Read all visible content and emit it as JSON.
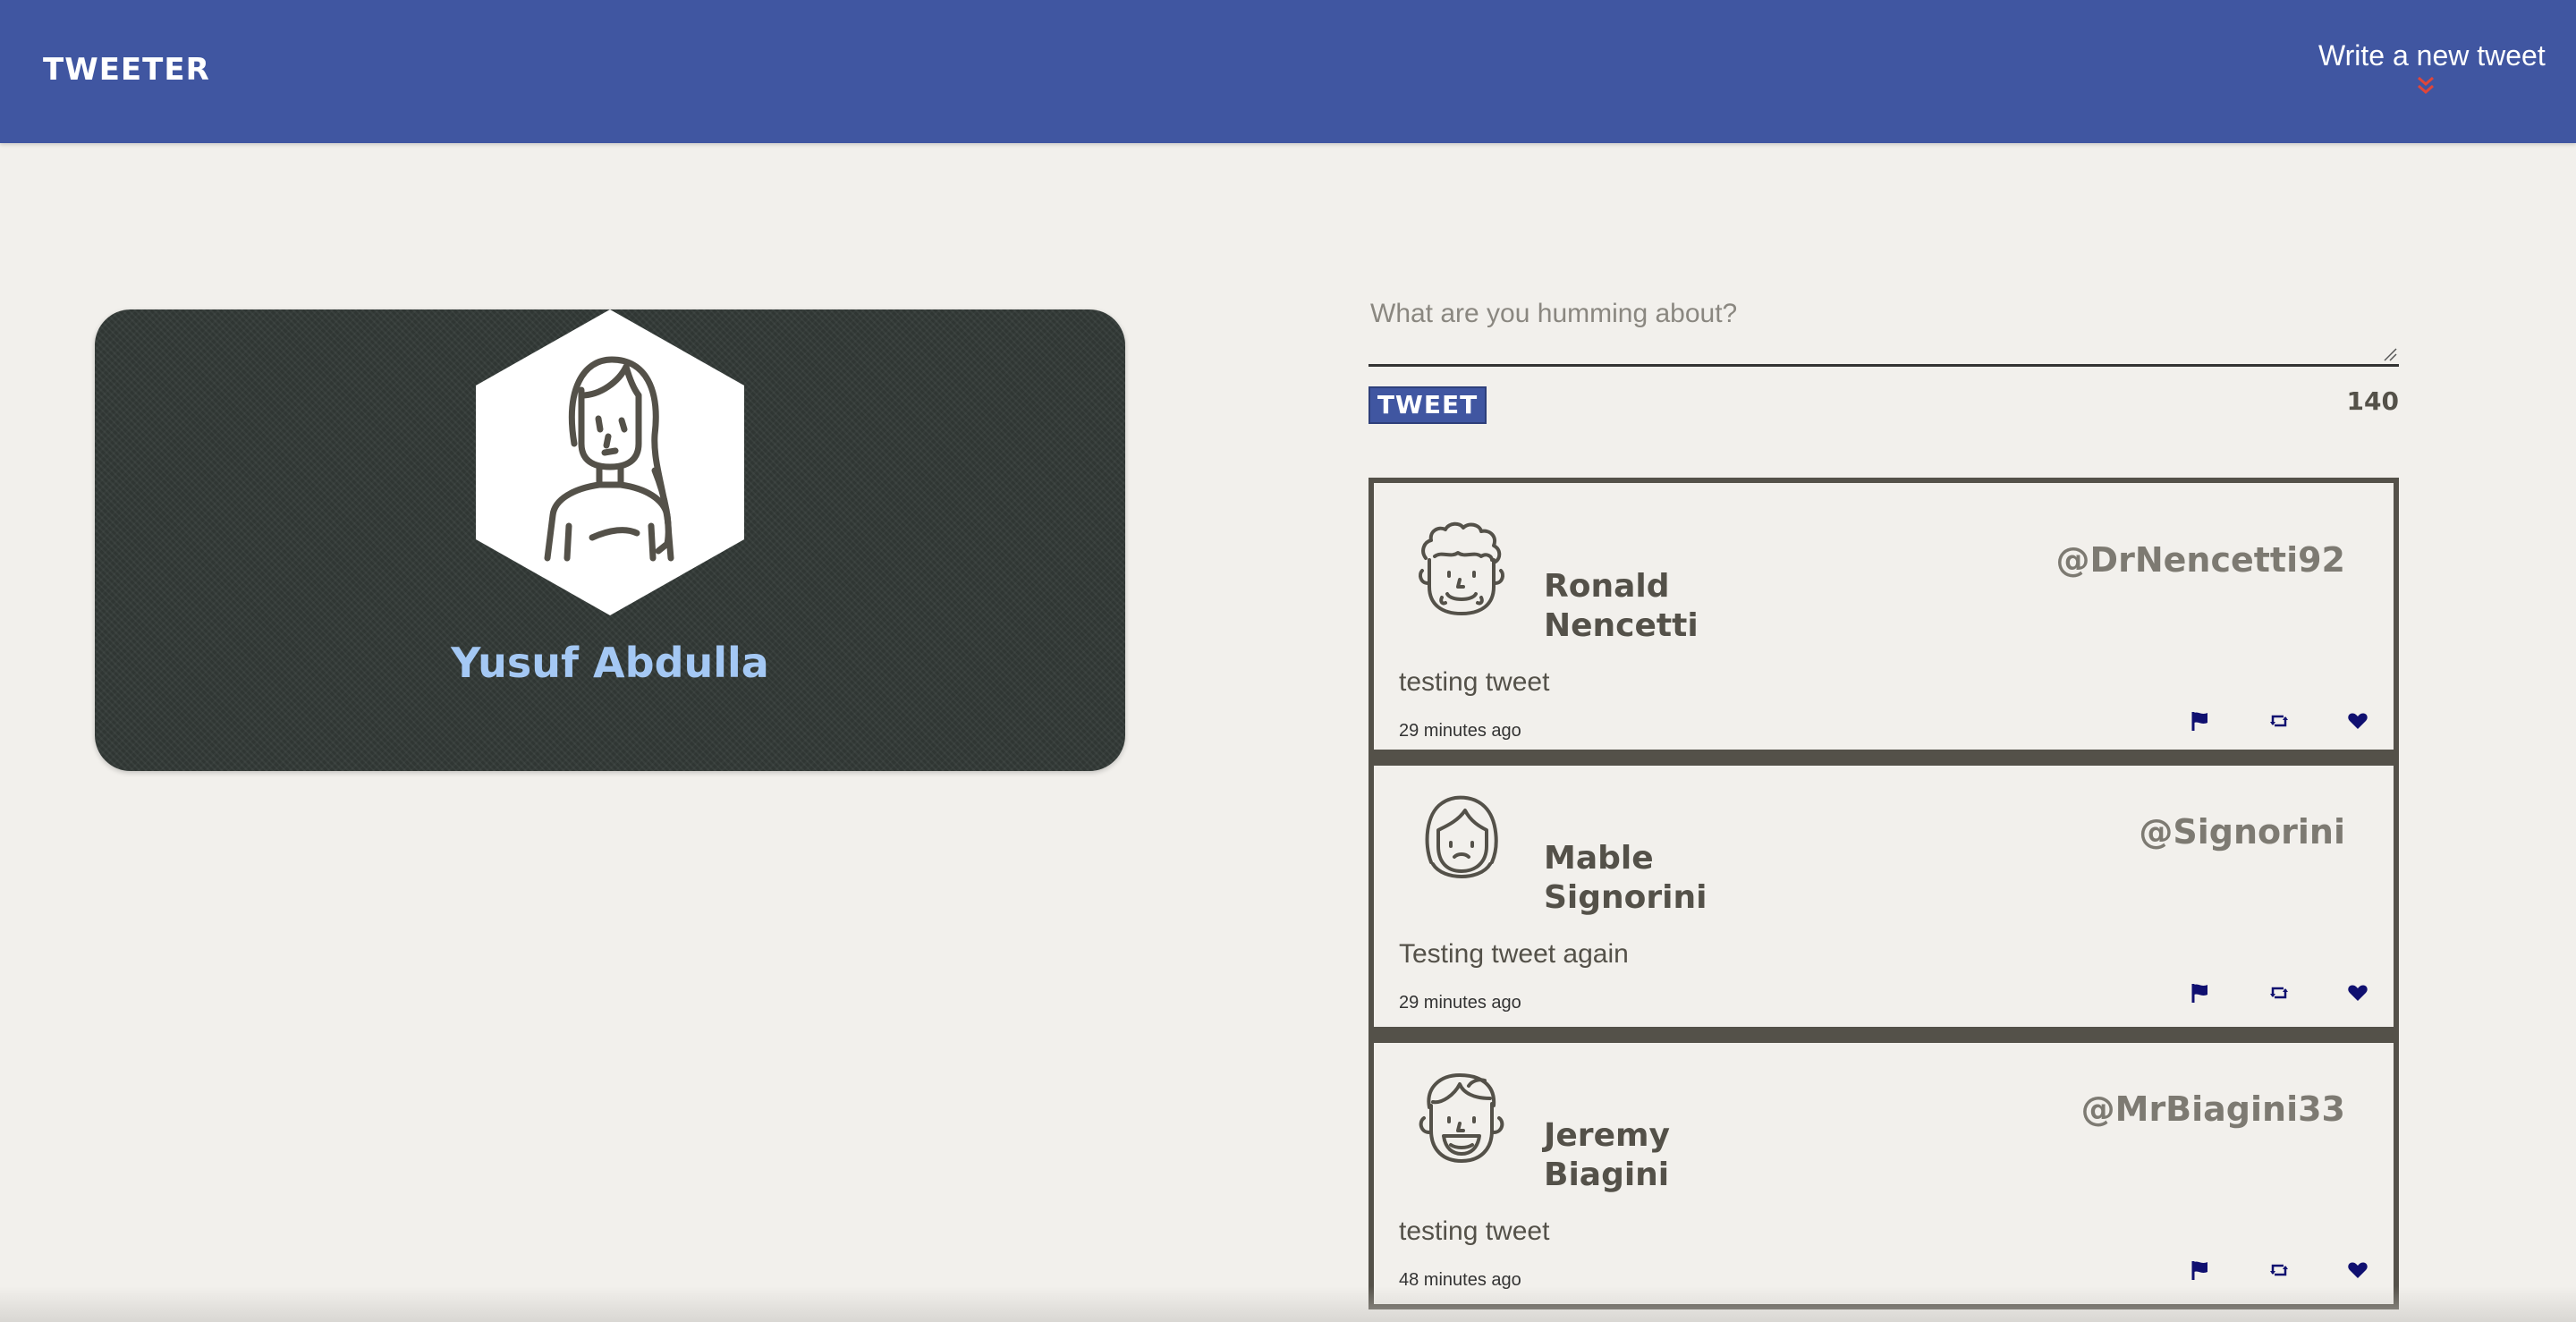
{
  "nav": {
    "logo": "TWEETER",
    "compose_label": "Write a new tweet",
    "compose_icon": "double-chevron-down-icon",
    "background": "#4056a1"
  },
  "profile": {
    "name": "Yusuf Abdulla",
    "avatar_icon": "female-avatar-icon"
  },
  "compose": {
    "placeholder": "What are you humming about?",
    "value": "",
    "button_label": "TWEET",
    "counter": "140"
  },
  "tweets": [
    {
      "name_line1": "Ronald",
      "name_line2": "Nencetti",
      "handle": "@DrNencetti92",
      "text": "testing tweet",
      "time": "29 minutes ago",
      "avatar_icon": "curly-hair-avatar-icon"
    },
    {
      "name_line1": "Mable",
      "name_line2": "Signorini",
      "handle": "@Signorini",
      "text": "Testing tweet again",
      "time": "29 minutes ago",
      "avatar_icon": "woman-avatar-icon"
    },
    {
      "name_line1": "Jeremy",
      "name_line2": "Biagini",
      "handle": "@MrBiagini33",
      "text": "testing tweet",
      "time": "48 minutes ago",
      "avatar_icon": "smiling-man-avatar-icon"
    }
  ],
  "actions": [
    "flag-icon",
    "retweet-icon",
    "heart-icon"
  ],
  "colors": {
    "accent": "#4056a1",
    "action_icon": "#101070",
    "profile_name": "#a4c8f4",
    "arrow": "#e0463a"
  }
}
